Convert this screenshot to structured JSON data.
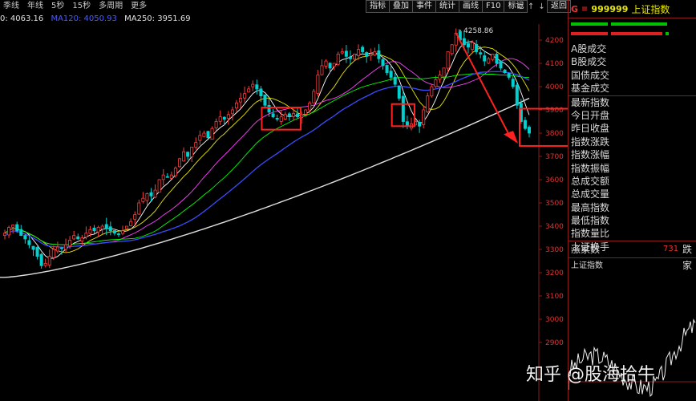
{
  "tabs": [
    "季线",
    "年线",
    "5秒",
    "15秒",
    "多周期",
    "更多"
  ],
  "toolbar": {
    "buttons": [
      "指标",
      "叠加",
      "事件",
      "统计",
      "画线",
      "F10",
      "标记"
    ],
    "icons": [
      "gear-icon",
      "arrow-up-icon",
      "arrow-down-icon"
    ]
  },
  "close_button": "返回",
  "ma_legend": {
    "items": [
      {
        "text": "0: 4063.16",
        "color": "#e0e0e0"
      },
      {
        "text": "MA120: 4050.93",
        "color": "#4a5bff"
      },
      {
        "text": "MA250: 3951.69",
        "color": "#e0e0e0"
      }
    ]
  },
  "chart_data": {
    "type": "candlestick",
    "price_ticks": [
      "4200",
      "4100",
      "4000",
      "3900",
      "3800",
      "3700",
      "3600",
      "3500",
      "3400",
      "3300",
      "3200",
      "3100",
      "3000",
      "2900"
    ],
    "yrange": [
      2900,
      4250
    ],
    "high_label": "4258.86",
    "series": [
      {
        "name": "MA120",
        "color": "#3a4cff"
      },
      {
        "name": "MA250",
        "color": "#e0e0e0"
      }
    ],
    "closes": [
      3370,
      3395,
      3405,
      3380,
      3360,
      3345,
      3320,
      3300,
      3270,
      3230,
      3240,
      3270,
      3300,
      3310,
      3305,
      3320,
      3340,
      3360,
      3345,
      3350,
      3370,
      3385,
      3380,
      3395,
      3400,
      3390,
      3380,
      3370,
      3365,
      3380,
      3400,
      3420,
      3450,
      3500,
      3520,
      3540,
      3530,
      3555,
      3600,
      3620,
      3610,
      3620,
      3650,
      3690,
      3720,
      3700,
      3740,
      3760,
      3790,
      3800,
      3780,
      3820,
      3850,
      3870,
      3860,
      3880,
      3900,
      3930,
      3950,
      3970,
      3990,
      4010,
      3990,
      3960,
      3920,
      3890,
      3870,
      3860,
      3870,
      3880,
      3875,
      3885,
      3870,
      3880,
      3900,
      3930,
      3980,
      4050,
      4090,
      4110,
      4080,
      4100,
      4140,
      4150,
      4130,
      4120,
      4140,
      4160,
      4150,
      4130,
      4140,
      4150,
      4120,
      4090,
      4060,
      4040,
      4010,
      3950,
      3850,
      3830,
      3840,
      3850,
      3830,
      3900,
      3960,
      4000,
      4030,
      4050,
      4080,
      4150,
      4180,
      4230,
      4200,
      4180,
      4170,
      4190,
      4150,
      4140,
      4110,
      4120,
      4140,
      4100,
      4080,
      4060,
      4040,
      4000,
      3920,
      3850,
      3820,
      3800
    ]
  },
  "annotations": {
    "boxes": 3,
    "arrow": "down"
  },
  "quote_panel": {
    "flag": "G",
    "menu": "≡",
    "code": "999999",
    "name": "上证指数",
    "rows_a": [
      "A股成交",
      "B股成交",
      "国债成交",
      "基金成交"
    ],
    "rows_b": [
      "最新指数",
      "今日开盘",
      "昨日收盘",
      "指数涨跌",
      "指数涨幅",
      "指数振幅",
      "总成交额",
      "总成交量",
      "最高指数",
      "最低指数",
      "指数量比",
      "上证换手"
    ],
    "adv_label": "涨家数",
    "adv_value": "731",
    "dec_label": "跌家",
    "mini_title": "上证指数"
  },
  "watermark": "知乎 @股海拾牛",
  "colors": {
    "up": "#ff3b3b",
    "down": "#00d0d0",
    "box": "#ff2020",
    "ma120": "#3a4cff",
    "ma250": "#e0e0e0"
  }
}
